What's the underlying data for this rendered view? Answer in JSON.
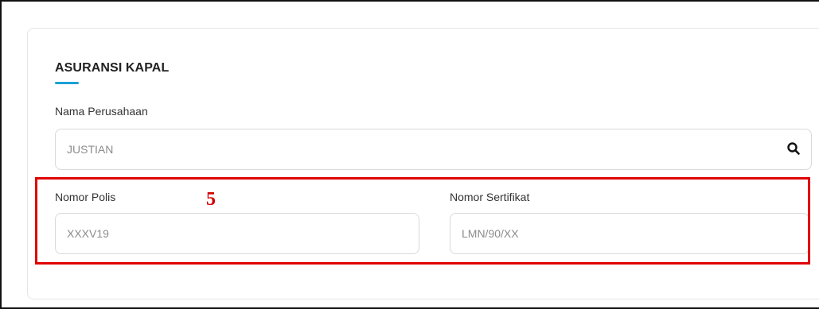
{
  "section": {
    "title": "ASURANSI KAPAL",
    "accent_color": "#1aa0d6"
  },
  "company": {
    "label": "Nama Perusahaan",
    "value": "JUSTIAN",
    "search_icon": "search-icon"
  },
  "policy": {
    "label": "Nomor Polis",
    "value": "XXXV19"
  },
  "certificate": {
    "label": "Nomor Sertifikat",
    "value": "LMN/90/XX"
  },
  "annotation": {
    "step_number": "5",
    "highlight_color": "#e00000"
  }
}
